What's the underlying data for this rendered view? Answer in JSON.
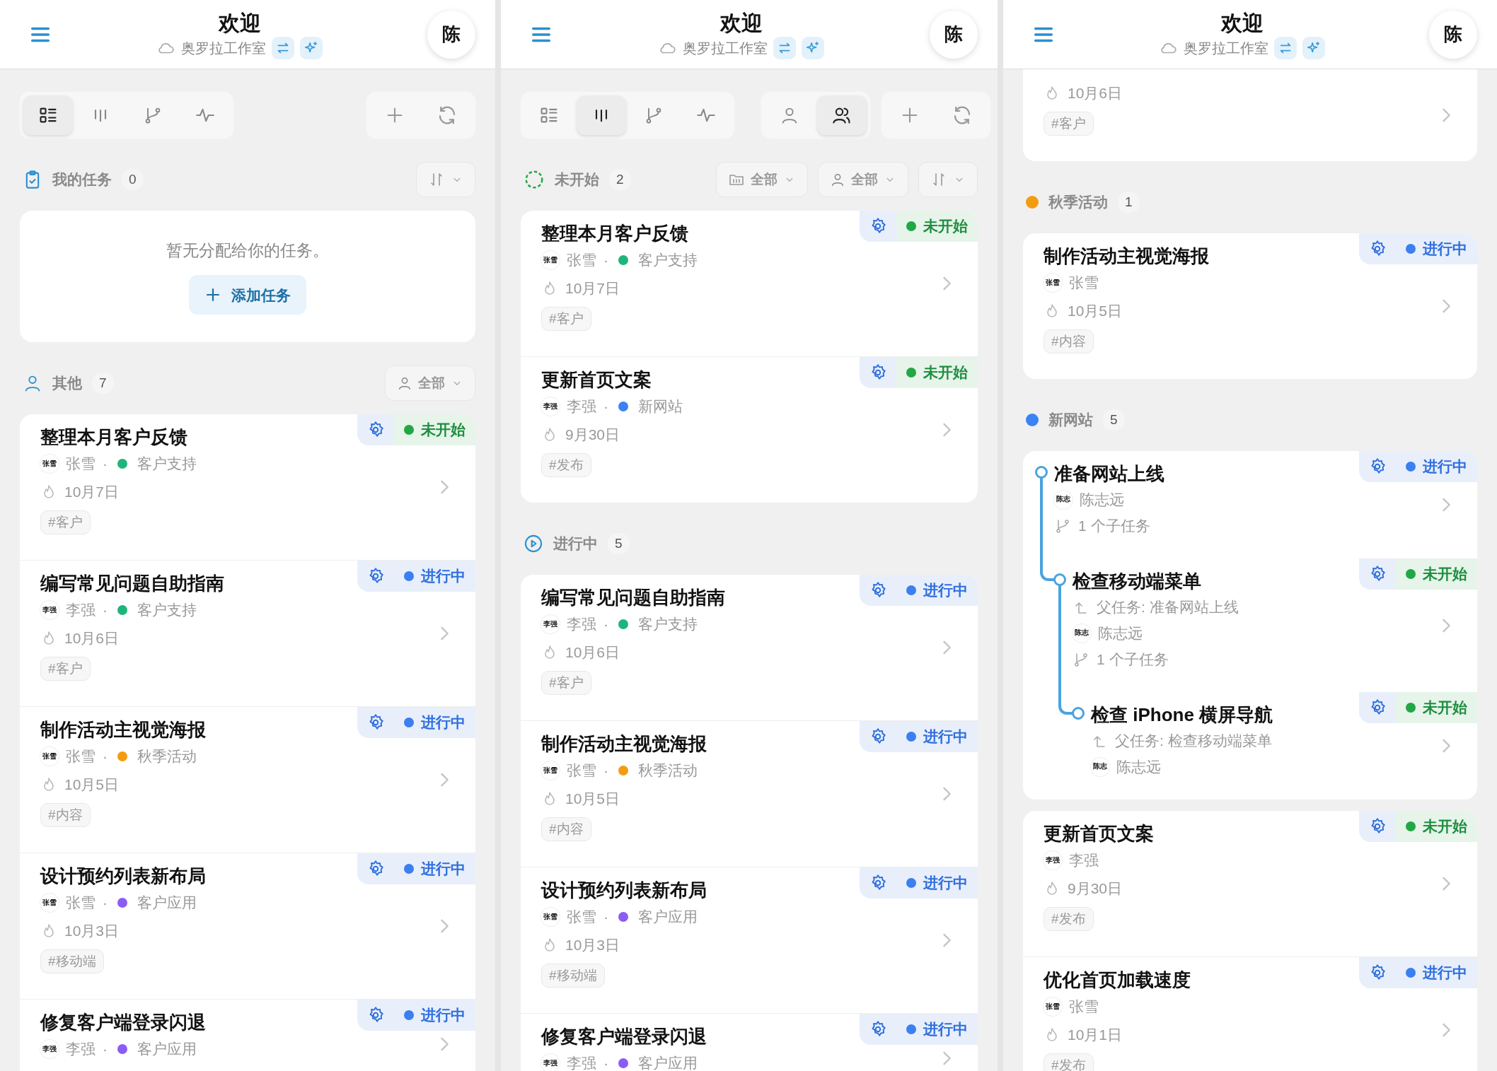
{
  "panels": [
    {
      "header": {
        "title": "欢迎",
        "workspace": "奥罗拉工作室",
        "avatar": "陈"
      },
      "view_tabs": [
        {
          "kind": "list",
          "selected": true
        },
        {
          "kind": "board",
          "selected": false
        },
        {
          "kind": "branch",
          "selected": false
        },
        {
          "kind": "pulse",
          "selected": false
        }
      ],
      "sections": [
        {
          "kind": "mine",
          "title": "我的任务",
          "count": "0",
          "filters": [
            {
              "kind": "sort"
            }
          ],
          "cards": [
            {
              "kind": "empty",
              "message": "暂无分配给你的任务。",
              "button": "添加任务"
            }
          ]
        },
        {
          "kind": "others",
          "title": "其他",
          "count": "7",
          "filters": [
            {
              "kind": "person",
              "label": "全部"
            }
          ],
          "cards": [
            {
              "kind": "tasks",
              "tasks": [
                {
                  "title": "整理本月客户反馈",
                  "status": {
                    "kind": "todo",
                    "label": "未开始"
                  },
                  "assignee": {
                    "initials": "张雪",
                    "name": "张雪"
                  },
                  "separator": "·",
                  "project": {
                    "name": "客户支持",
                    "color": "#1fb57a"
                  },
                  "due": "10月7日",
                  "tag": "#客户"
                },
                {
                  "title": "编写常见问题自助指南",
                  "status": {
                    "kind": "doing",
                    "label": "进行中"
                  },
                  "assignee": {
                    "initials": "李强",
                    "name": "李强"
                  },
                  "separator": "·",
                  "project": {
                    "name": "客户支持",
                    "color": "#1fb57a"
                  },
                  "due": "10月6日",
                  "tag": "#客户"
                },
                {
                  "title": "制作活动主视觉海报",
                  "status": {
                    "kind": "doing",
                    "label": "进行中"
                  },
                  "assignee": {
                    "initials": "张雪",
                    "name": "张雪"
                  },
                  "separator": "·",
                  "project": {
                    "name": "秋季活动",
                    "color": "#f39c12"
                  },
                  "due": "10月5日",
                  "tag": "#内容"
                },
                {
                  "title": "设计预约列表新布局",
                  "status": {
                    "kind": "doing",
                    "label": "进行中"
                  },
                  "assignee": {
                    "initials": "张雪",
                    "name": "张雪"
                  },
                  "separator": "·",
                  "project": {
                    "name": "客户应用",
                    "color": "#8b5cf6"
                  },
                  "due": "10月3日",
                  "tag": "#移动端"
                },
                {
                  "title": "修复客户端登录闪退",
                  "status": {
                    "kind": "doing",
                    "label": "进行中"
                  },
                  "assignee": {
                    "initials": "李强",
                    "name": "李强"
                  },
                  "separator": "·",
                  "project": {
                    "name": "客户应用",
                    "color": "#8b5cf6"
                  }
                }
              ]
            }
          ]
        }
      ]
    },
    {
      "header": {
        "title": "欢迎",
        "workspace": "奥罗拉工作室",
        "avatar": "陈"
      },
      "view_tabs": [
        {
          "kind": "list",
          "selected": false
        },
        {
          "kind": "board",
          "selected": true
        },
        {
          "kind": "branch",
          "selected": false
        },
        {
          "kind": "pulse",
          "selected": false
        }
      ],
      "scope_tabs": [
        {
          "kind": "person",
          "selected": false
        },
        {
          "kind": "people",
          "selected": true
        }
      ],
      "sections": [
        {
          "kind": "todo",
          "title": "未开始",
          "count": "2",
          "filters": [
            {
              "kind": "folder",
              "label": "全部"
            },
            {
              "kind": "person",
              "label": "全部"
            },
            {
              "kind": "sort"
            }
          ],
          "cards": [
            {
              "kind": "tasks",
              "tasks": [
                {
                  "title": "整理本月客户反馈",
                  "status": {
                    "kind": "todo",
                    "label": "未开始"
                  },
                  "assignee": {
                    "initials": "张雪",
                    "name": "张雪"
                  },
                  "separator": "·",
                  "project": {
                    "name": "客户支持",
                    "color": "#1fb57a"
                  },
                  "due": "10月7日",
                  "tag": "#客户"
                },
                {
                  "title": "更新首页文案",
                  "status": {
                    "kind": "todo",
                    "label": "未开始"
                  },
                  "assignee": {
                    "initials": "李强",
                    "name": "李强"
                  },
                  "separator": "·",
                  "project": {
                    "name": "新网站",
                    "color": "#3b82f6"
                  },
                  "due": "9月30日",
                  "tag": "#发布"
                }
              ]
            }
          ]
        },
        {
          "kind": "doing",
          "title": "进行中",
          "count": "5",
          "cards": [
            {
              "kind": "tasks",
              "tasks": [
                {
                  "title": "编写常见问题自助指南",
                  "status": {
                    "kind": "doing",
                    "label": "进行中"
                  },
                  "assignee": {
                    "initials": "李强",
                    "name": "李强"
                  },
                  "separator": "·",
                  "project": {
                    "name": "客户支持",
                    "color": "#1fb57a"
                  },
                  "due": "10月6日",
                  "tag": "#客户"
                },
                {
                  "title": "制作活动主视觉海报",
                  "status": {
                    "kind": "doing",
                    "label": "进行中"
                  },
                  "assignee": {
                    "initials": "张雪",
                    "name": "张雪"
                  },
                  "separator": "·",
                  "project": {
                    "name": "秋季活动",
                    "color": "#f39c12"
                  },
                  "due": "10月5日",
                  "tag": "#内容"
                },
                {
                  "title": "设计预约列表新布局",
                  "status": {
                    "kind": "doing",
                    "label": "进行中"
                  },
                  "assignee": {
                    "initials": "张雪",
                    "name": "张雪"
                  },
                  "separator": "·",
                  "project": {
                    "name": "客户应用",
                    "color": "#8b5cf6"
                  },
                  "due": "10月3日",
                  "tag": "#移动端"
                },
                {
                  "title": "修复客户端登录闪退",
                  "status": {
                    "kind": "doing",
                    "label": "进行中"
                  },
                  "assignee": {
                    "initials": "李强",
                    "name": "李强"
                  },
                  "separator": "·",
                  "project": {
                    "name": "客户应用",
                    "color": "#8b5cf6"
                  }
                }
              ]
            }
          ]
        }
      ]
    },
    {
      "header": {
        "title": "欢迎",
        "workspace": "奥罗拉工作室",
        "avatar": "陈"
      },
      "sections": [
        {
          "kind": "continued",
          "cards": [
            {
              "kind": "tasks",
              "tasks": [
                {
                  "due": "10月6日",
                  "tag": "#客户"
                }
              ]
            }
          ]
        },
        {
          "kind": "project",
          "title": "秋季活动",
          "count": "1",
          "color": "#f39c12",
          "cards": [
            {
              "kind": "tasks",
              "tasks": [
                {
                  "title": "制作活动主视觉海报",
                  "status": {
                    "kind": "doing",
                    "label": "进行中"
                  },
                  "assignee": {
                    "initials": "张雪",
                    "name": "张雪"
                  },
                  "due": "10月5日",
                  "tag": "#内容"
                }
              ]
            }
          ]
        },
        {
          "kind": "project",
          "title": "新网站",
          "count": "5",
          "color": "#3b82f6",
          "cards": [
            {
              "kind": "tree",
              "tasks": [
                {
                  "title": "准备网站上线",
                  "status": {
                    "kind": "doing",
                    "label": "进行中"
                  },
                  "assignee": {
                    "initials": "陈志",
                    "name": "陈志远"
                  },
                  "subtasks": "1 个子任务",
                  "children": [
                    {
                      "title": "检查移动端菜单",
                      "status": {
                        "kind": "todo",
                        "label": "未开始"
                      },
                      "parent": "父任务: 准备网站上线",
                      "assignee": {
                        "initials": "陈志",
                        "name": "陈志远"
                      },
                      "subtasks": "1 个子任务",
                      "children": [
                        {
                          "title": "检查 iPhone 横屏导航",
                          "status": {
                            "kind": "todo",
                            "label": "未开始"
                          },
                          "parent": "父任务: 检查移动端菜单",
                          "assignee": {
                            "initials": "陈志",
                            "name": "陈志远"
                          }
                        }
                      ]
                    }
                  ]
                }
              ]
            },
            {
              "kind": "tasks",
              "tasks": [
                {
                  "title": "更新首页文案",
                  "status": {
                    "kind": "todo",
                    "label": "未开始"
                  },
                  "assignee": {
                    "initials": "李强",
                    "name": "李强"
                  },
                  "due": "9月30日",
                  "tag": "#发布"
                },
                {
                  "title": "优化首页加载速度",
                  "status": {
                    "kind": "doing",
                    "label": "进行中"
                  },
                  "assignee": {
                    "initials": "张雪",
                    "name": "张雪"
                  },
                  "due": "10月1日",
                  "tag": "#发布"
                }
              ]
            }
          ]
        }
      ]
    }
  ]
}
